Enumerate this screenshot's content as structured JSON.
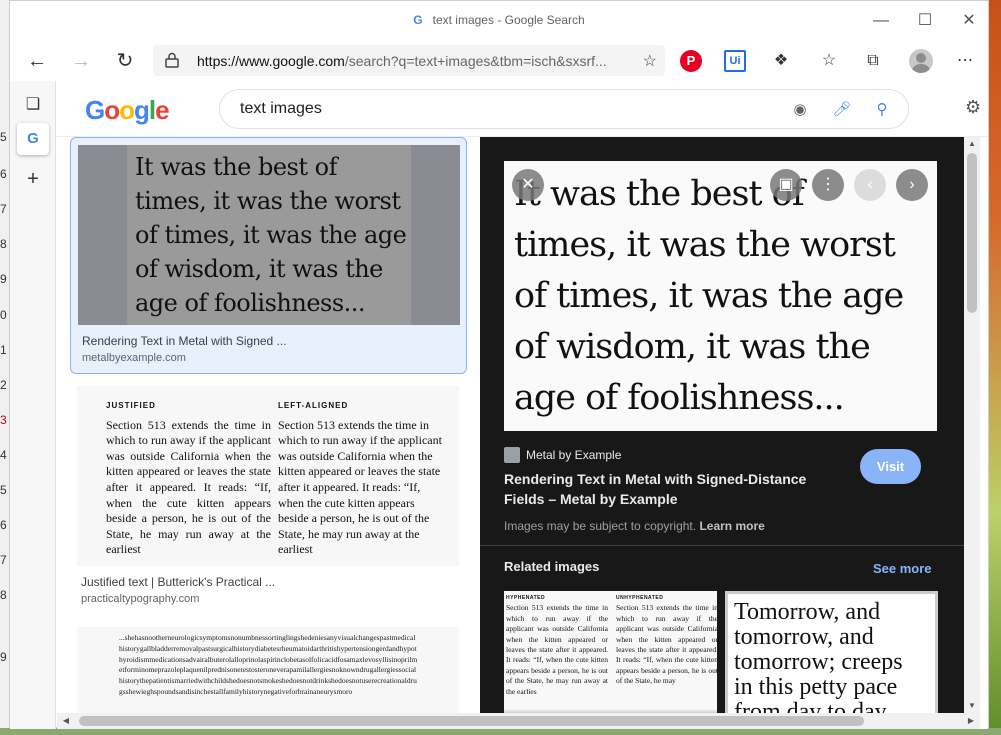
{
  "window": {
    "title": "text images - Google Search",
    "minimize_icon": "minimize-icon",
    "maximize_icon": "maximize-icon",
    "close_icon": "close-icon"
  },
  "toolbar": {
    "url_host": "https://www.google.com",
    "url_path": "/search?q=text+images&tbm=isch&sxsrf...",
    "extensions": [
      {
        "name": "pinterest-icon",
        "color": "#e60023"
      },
      {
        "name": "ui-extension-icon",
        "color": "#1e6ee8"
      },
      {
        "name": "puzzle-icon",
        "color": "#333333"
      }
    ]
  },
  "google": {
    "query": "text images",
    "logo_letters": [
      "G",
      "o",
      "o",
      "g",
      "l",
      "e"
    ]
  },
  "results": [
    {
      "title": "Rendering Text in Metal with Signed ...",
      "source": "metalbyexample.com",
      "image_text": "It was the best of\ntimes, it was the worst\nof times, it was the age\nof wisdom, it was the\nage of foolishness..."
    },
    {
      "title": "Justified text | Butterick's Practical ...",
      "source": "practicaltypography.com",
      "col1_head": "JUSTIFIED",
      "col2_head": "LEFT-ALIGNED",
      "col1_text": "Section 513 extends the time in which to run away if the applicant was outside California when the kitten appeared or leaves the state after it appeared. It reads: “If, when the cute kitten appears beside a person, he is out of the State, he may run away at the earliest",
      "col2_text": "Section 513 extends the time in which to run away if the applicant was outside California when the kitten appeared or leaves the state after it appeared. It reads: “If, when the cute kitten appears beside a person, he is out of the State, he may run away at the earliest"
    },
    {
      "image_text": "...shehasnootherneurologicsymptomsnonumbnessortinglingshedeniesanyvisualchangespastmedicalhistorygallbladderremovalpastsurgicalhistorydiabetesrheumatoidarthritishypertensiongerdandhypothyroidismmedicationsadvairalbuterolalloprinolaspirinclobetasolfolicacidfosamaxlevosyllisinoprilmetforminomeprazoleplaquenilprednisonetestosteroneverapamilallergiesnoknowndrugallergiessocialhistorythepatientismarriedwithchildshedoesnotsmokeshedoesnotdrinkshedoesnotuserecreationaldrugsshewieghspoundsandisinchestallfamilyhistorynegativeforbrainaneurysmoro"
    }
  ],
  "preview": {
    "image_text": "It was the best of\ntimes, it was the worst\nof times, it was the age\nof wisdom, it was the\nage of foolishness...",
    "source": "Metal by Example",
    "title": "Rendering Text in Metal with Signed-Distance Fields – Metal by Example",
    "visit_label": "Visit",
    "copyright": "Images may be subject to copyright.",
    "learn_more": "Learn more",
    "related_heading": "Related images",
    "see_more": "See more",
    "related": [
      {
        "caption": "Justified text | Butterick's Practical ...",
        "col1_head": "HYPHENATED",
        "col2_head": "UNHYPHENATED",
        "col1_text": "Section 513 extends the time in which to run away if the applicant was outside California when the kitten appeared or leaves the state after it appeared. It reads: “If, when the cute kitten appears beside a person, he is out of the State, he may run away at the earlies",
        "col2_text": "Section 513 extends the time in which to run away if the applicant was outside California when the kitten appeared or leaves the state after it appeared. It reads: “If, when the cute kitten appears beside a person, he is out of the State, he may"
      },
      {
        "image_text": "Tomorrow, and\ntomorrow, and\ntomorrow; creeps\nin this petty pace\nfrom day to day"
      }
    ]
  },
  "desktop": {
    "edge_numbers": [
      "5",
      "6",
      "7",
      "8",
      "9",
      "0",
      "1",
      "2",
      "3",
      "4",
      "5",
      "6",
      "7",
      "8",
      "9"
    ]
  }
}
